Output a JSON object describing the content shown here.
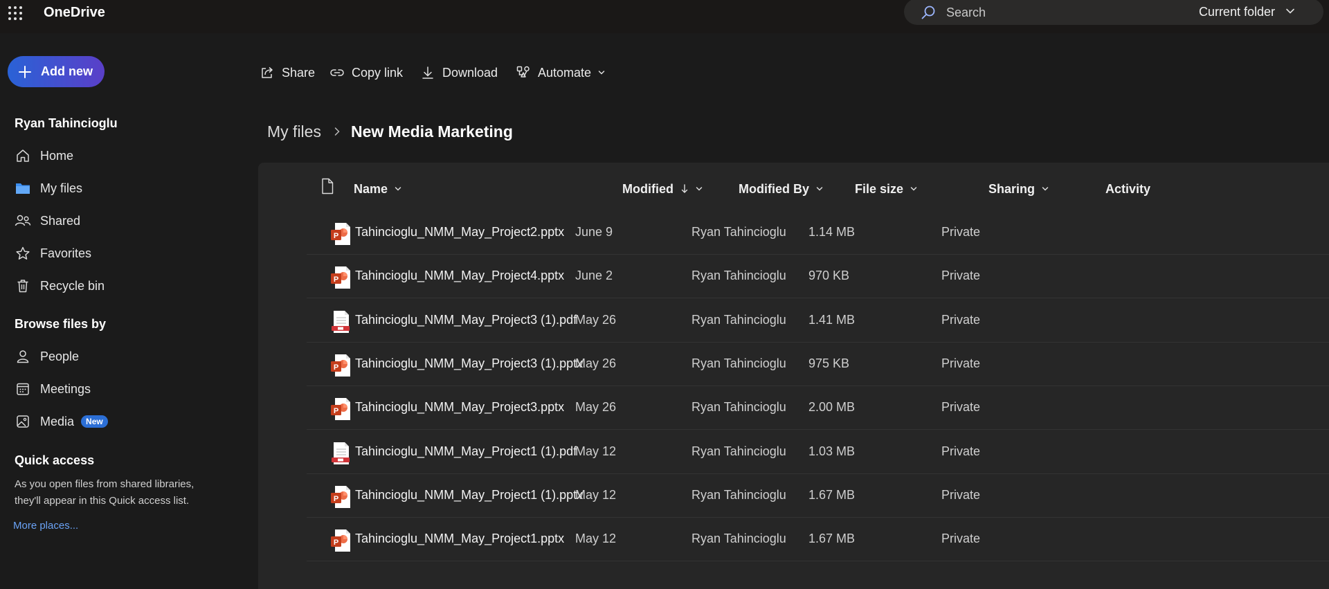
{
  "app": {
    "title": "OneDrive"
  },
  "search": {
    "placeholder": "Search",
    "scope": "Current folder"
  },
  "sidebar": {
    "add_new_label": "Add new",
    "user_name": "Ryan Tahincioglu",
    "items": [
      {
        "label": "Home",
        "icon": "home-icon"
      },
      {
        "label": "My files",
        "icon": "folder-icon"
      },
      {
        "label": "Shared",
        "icon": "people-icon"
      },
      {
        "label": "Favorites",
        "icon": "star-icon"
      },
      {
        "label": "Recycle bin",
        "icon": "trash-icon"
      }
    ],
    "browse_heading": "Browse files by",
    "browse_items": [
      {
        "label": "People",
        "icon": "person-icon"
      },
      {
        "label": "Meetings",
        "icon": "calendar-icon"
      },
      {
        "label": "Media",
        "icon": "image-icon",
        "badge": "New"
      }
    ],
    "quick_access_heading": "Quick access",
    "quick_access_text": "As you open files from shared libraries, they'll appear in this Quick access list.",
    "more_places": "More places..."
  },
  "commands": {
    "share": "Share",
    "copy_link": "Copy link",
    "download": "Download",
    "automate": "Automate"
  },
  "breadcrumb": {
    "root": "My files",
    "current": "New Media Marketing"
  },
  "columns": {
    "name": "Name",
    "modified": "Modified",
    "modified_by": "Modified By",
    "file_size": "File size",
    "sharing": "Sharing",
    "activity": "Activity"
  },
  "files": [
    {
      "name": "Tahincioglu_NMM_May_Project2.pptx",
      "type": "pptx",
      "modified": "June 9",
      "modified_by": "Ryan Tahincioglu",
      "size": "1.14 MB",
      "sharing": "Private"
    },
    {
      "name": "Tahincioglu_NMM_May_Project4.pptx",
      "type": "pptx",
      "modified": "June 2",
      "modified_by": "Ryan Tahincioglu",
      "size": "970 KB",
      "sharing": "Private"
    },
    {
      "name": "Tahincioglu_NMM_May_Project3 (1).pdf",
      "type": "pdf",
      "modified": "May 26",
      "modified_by": "Ryan Tahincioglu",
      "size": "1.41 MB",
      "sharing": "Private"
    },
    {
      "name": "Tahincioglu_NMM_May_Project3 (1).pptx",
      "type": "pptx",
      "modified": "May 26",
      "modified_by": "Ryan Tahincioglu",
      "size": "975 KB",
      "sharing": "Private"
    },
    {
      "name": "Tahincioglu_NMM_May_Project3.pptx",
      "type": "pptx",
      "modified": "May 26",
      "modified_by": "Ryan Tahincioglu",
      "size": "2.00 MB",
      "sharing": "Private"
    },
    {
      "name": "Tahincioglu_NMM_May_Project1 (1).pdf",
      "type": "pdf",
      "modified": "May 12",
      "modified_by": "Ryan Tahincioglu",
      "size": "1.03 MB",
      "sharing": "Private"
    },
    {
      "name": "Tahincioglu_NMM_May_Project1 (1).pptx",
      "type": "pptx",
      "modified": "May 12",
      "modified_by": "Ryan Tahincioglu",
      "size": "1.67 MB",
      "sharing": "Private"
    },
    {
      "name": "Tahincioglu_NMM_May_Project1.pptx",
      "type": "pptx",
      "modified": "May 12",
      "modified_by": "Ryan Tahincioglu",
      "size": "1.67 MB",
      "sharing": "Private"
    }
  ],
  "colors": {
    "accent": "#2a62d6",
    "pptx": "#c43e1c",
    "pdf": "#d13438",
    "link": "#6aa2f5"
  }
}
